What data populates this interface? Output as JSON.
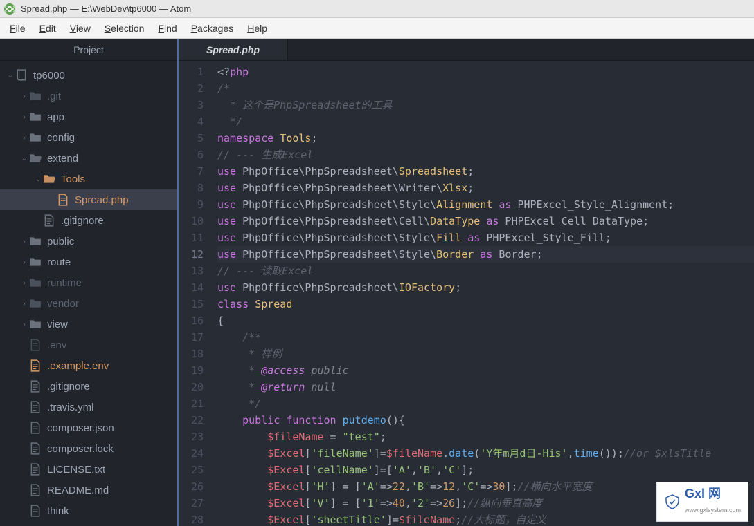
{
  "window": {
    "title": "Spread.php — E:\\WebDev\\tp6000 — Atom"
  },
  "menu": {
    "items": [
      "File",
      "Edit",
      "View",
      "Selection",
      "Find",
      "Packages",
      "Help"
    ]
  },
  "sidebar": {
    "title": "Project",
    "tree": [
      {
        "depth": 0,
        "name": "tp6000",
        "type": "repo",
        "expanded": true
      },
      {
        "depth": 1,
        "name": ".git",
        "type": "folder",
        "collapsed": true,
        "ignored": true
      },
      {
        "depth": 1,
        "name": "app",
        "type": "folder",
        "collapsed": true
      },
      {
        "depth": 1,
        "name": "config",
        "type": "folder",
        "collapsed": true
      },
      {
        "depth": 1,
        "name": "extend",
        "type": "folder",
        "expanded": true
      },
      {
        "depth": 2,
        "name": "Tools",
        "type": "folder",
        "expanded": true,
        "modified": true
      },
      {
        "depth": 3,
        "name": "Spread.php",
        "type": "file",
        "selected": true,
        "modified": true
      },
      {
        "depth": 2,
        "name": ".gitignore",
        "type": "file"
      },
      {
        "depth": 1,
        "name": "public",
        "type": "folder",
        "collapsed": true
      },
      {
        "depth": 1,
        "name": "route",
        "type": "folder",
        "collapsed": true
      },
      {
        "depth": 1,
        "name": "runtime",
        "type": "folder",
        "collapsed": true,
        "ignored": true
      },
      {
        "depth": 1,
        "name": "vendor",
        "type": "folder",
        "collapsed": true,
        "ignored": true
      },
      {
        "depth": 1,
        "name": "view",
        "type": "folder",
        "collapsed": true
      },
      {
        "depth": 1,
        "name": ".env",
        "type": "file",
        "ignored": true
      },
      {
        "depth": 1,
        "name": ".example.env",
        "type": "file",
        "modified": true
      },
      {
        "depth": 1,
        "name": ".gitignore",
        "type": "file"
      },
      {
        "depth": 1,
        "name": ".travis.yml",
        "type": "file"
      },
      {
        "depth": 1,
        "name": "composer.json",
        "type": "file"
      },
      {
        "depth": 1,
        "name": "composer.lock",
        "type": "file"
      },
      {
        "depth": 1,
        "name": "LICENSE.txt",
        "type": "file"
      },
      {
        "depth": 1,
        "name": "README.md",
        "type": "file"
      },
      {
        "depth": 1,
        "name": "think",
        "type": "file"
      }
    ]
  },
  "tabs": {
    "active": "Spread.php"
  },
  "editor": {
    "highlight_line": 12,
    "lines": [
      {
        "n": 1,
        "tokens": [
          [
            "pun",
            "<?"
          ],
          [
            "kw",
            "php"
          ]
        ]
      },
      {
        "n": 2,
        "tokens": [
          [
            "cm",
            "/*"
          ]
        ]
      },
      {
        "n": 3,
        "tokens": [
          [
            "cm",
            "  * 这个是PhpSpreadsheet的工具"
          ]
        ]
      },
      {
        "n": 4,
        "tokens": [
          [
            "cm",
            "  */"
          ]
        ]
      },
      {
        "n": 5,
        "tokens": [
          [
            "kw",
            "namespace"
          ],
          [
            "op",
            " "
          ],
          [
            "cls",
            "Tools"
          ],
          [
            "pun",
            ";"
          ]
        ]
      },
      {
        "n": 6,
        "tokens": [
          [
            "cm",
            "// --- 生成Excel"
          ]
        ]
      },
      {
        "n": 7,
        "tokens": [
          [
            "kw",
            "use"
          ],
          [
            "op",
            " PhpOffice\\PhpSpreadsheet\\"
          ],
          [
            "cls",
            "Spreadsheet"
          ],
          [
            "pun",
            ";"
          ]
        ]
      },
      {
        "n": 8,
        "tokens": [
          [
            "kw",
            "use"
          ],
          [
            "op",
            " PhpOffice\\PhpSpreadsheet\\Writer\\"
          ],
          [
            "cls",
            "Xlsx"
          ],
          [
            "pun",
            ";"
          ]
        ]
      },
      {
        "n": 9,
        "tokens": [
          [
            "kw",
            "use"
          ],
          [
            "op",
            " PhpOffice\\PhpSpreadsheet\\Style\\"
          ],
          [
            "cls",
            "Alignment"
          ],
          [
            "op",
            " "
          ],
          [
            "kw",
            "as"
          ],
          [
            "op",
            " PHPExcel_Style_Alignment"
          ],
          [
            "pun",
            ";"
          ]
        ]
      },
      {
        "n": 10,
        "tokens": [
          [
            "kw",
            "use"
          ],
          [
            "op",
            " PhpOffice\\PhpSpreadsheet\\Cell\\"
          ],
          [
            "cls",
            "DataType"
          ],
          [
            "op",
            " "
          ],
          [
            "kw",
            "as"
          ],
          [
            "op",
            " PHPExcel_Cell_DataType"
          ],
          [
            "pun",
            ";"
          ]
        ]
      },
      {
        "n": 11,
        "tokens": [
          [
            "kw",
            "use"
          ],
          [
            "op",
            " PhpOffice\\PhpSpreadsheet\\Style\\"
          ],
          [
            "cls",
            "Fill"
          ],
          [
            "op",
            " "
          ],
          [
            "kw",
            "as"
          ],
          [
            "op",
            " PHPExcel_Style_Fill"
          ],
          [
            "pun",
            ";"
          ]
        ]
      },
      {
        "n": 12,
        "tokens": [
          [
            "kw",
            "use"
          ],
          [
            "op",
            " PhpOffice\\PhpSpreadsheet\\Style\\"
          ],
          [
            "cls",
            "Border"
          ],
          [
            "op",
            " "
          ],
          [
            "kw",
            "as"
          ],
          [
            "op",
            " Border"
          ],
          [
            "pun",
            ";"
          ]
        ]
      },
      {
        "n": 13,
        "tokens": [
          [
            "cm",
            "// --- 读取Excel"
          ]
        ]
      },
      {
        "n": 14,
        "tokens": [
          [
            "kw",
            "use"
          ],
          [
            "op",
            " PhpOffice\\PhpSpreadsheet\\"
          ],
          [
            "cls",
            "IOFactory"
          ],
          [
            "pun",
            ";"
          ]
        ]
      },
      {
        "n": 15,
        "tokens": [
          [
            "kw",
            "class"
          ],
          [
            "op",
            " "
          ],
          [
            "cls",
            "Spread"
          ]
        ]
      },
      {
        "n": 16,
        "tokens": [
          [
            "pun",
            "{"
          ]
        ]
      },
      {
        "n": 17,
        "tokens": [
          [
            "cm",
            "    /**"
          ]
        ]
      },
      {
        "n": 18,
        "tokens": [
          [
            "cm",
            "     * 样例"
          ]
        ]
      },
      {
        "n": 19,
        "tokens": [
          [
            "cm",
            "     * "
          ],
          [
            "dockey",
            "@access"
          ],
          [
            "cm2",
            " public"
          ]
        ]
      },
      {
        "n": 20,
        "tokens": [
          [
            "cm",
            "     * "
          ],
          [
            "dockey",
            "@return"
          ],
          [
            "cm2",
            " null"
          ]
        ]
      },
      {
        "n": 21,
        "tokens": [
          [
            "cm",
            "     */"
          ]
        ]
      },
      {
        "n": 22,
        "tokens": [
          [
            "op",
            "    "
          ],
          [
            "kw",
            "public"
          ],
          [
            "op",
            " "
          ],
          [
            "kw",
            "function"
          ],
          [
            "op",
            " "
          ],
          [
            "fn",
            "putdemo"
          ],
          [
            "pun",
            "(){"
          ]
        ]
      },
      {
        "n": 23,
        "tokens": [
          [
            "op",
            "        "
          ],
          [
            "var",
            "$fileName"
          ],
          [
            "op",
            " = "
          ],
          [
            "str",
            "\"test\""
          ],
          [
            "pun",
            ";"
          ]
        ]
      },
      {
        "n": 24,
        "tokens": [
          [
            "op",
            "        "
          ],
          [
            "var",
            "$Excel"
          ],
          [
            "pun",
            "["
          ],
          [
            "str",
            "'fileName'"
          ],
          [
            "pun",
            "]="
          ],
          [
            "var",
            "$fileName"
          ],
          [
            "pun",
            "."
          ],
          [
            "fn",
            "date"
          ],
          [
            "pun",
            "("
          ],
          [
            "str",
            "'Y年m月d日-His'"
          ],
          [
            "pun",
            ","
          ],
          [
            "fn",
            "time"
          ],
          [
            "pun",
            "());"
          ],
          [
            "cm",
            "//or $xlsTitle"
          ]
        ]
      },
      {
        "n": 25,
        "tokens": [
          [
            "op",
            "        "
          ],
          [
            "var",
            "$Excel"
          ],
          [
            "pun",
            "["
          ],
          [
            "str",
            "'cellName'"
          ],
          [
            "pun",
            "]=["
          ],
          [
            "str",
            "'A'"
          ],
          [
            "pun",
            ","
          ],
          [
            "str",
            "'B'"
          ],
          [
            "pun",
            ","
          ],
          [
            "str",
            "'C'"
          ],
          [
            "pun",
            "];"
          ]
        ]
      },
      {
        "n": 26,
        "tokens": [
          [
            "op",
            "        "
          ],
          [
            "var",
            "$Excel"
          ],
          [
            "pun",
            "["
          ],
          [
            "str",
            "'H'"
          ],
          [
            "pun",
            "] = ["
          ],
          [
            "str",
            "'A'"
          ],
          [
            "pun",
            "=>"
          ],
          [
            "num",
            "22"
          ],
          [
            "pun",
            ","
          ],
          [
            "str",
            "'B'"
          ],
          [
            "pun",
            "=>"
          ],
          [
            "num",
            "12"
          ],
          [
            "pun",
            ","
          ],
          [
            "str",
            "'C'"
          ],
          [
            "pun",
            "=>"
          ],
          [
            "num",
            "30"
          ],
          [
            "pun",
            "];"
          ],
          [
            "cm",
            "//横向水平宽度"
          ]
        ]
      },
      {
        "n": 27,
        "tokens": [
          [
            "op",
            "        "
          ],
          [
            "var",
            "$Excel"
          ],
          [
            "pun",
            "["
          ],
          [
            "str",
            "'V'"
          ],
          [
            "pun",
            "] = ["
          ],
          [
            "str",
            "'1'"
          ],
          [
            "pun",
            "=>"
          ],
          [
            "num",
            "40"
          ],
          [
            "pun",
            ","
          ],
          [
            "str",
            "'2'"
          ],
          [
            "pun",
            "=>"
          ],
          [
            "num",
            "26"
          ],
          [
            "pun",
            "];"
          ],
          [
            "cm",
            "//纵向垂直高度"
          ]
        ]
      },
      {
        "n": 28,
        "tokens": [
          [
            "op",
            "        "
          ],
          [
            "var",
            "$Excel"
          ],
          [
            "pun",
            "["
          ],
          [
            "str",
            "'sheetTitle'"
          ],
          [
            "pun",
            "]="
          ],
          [
            "var",
            "$fileName"
          ],
          [
            "pun",
            ";"
          ],
          [
            "cm",
            "//大标题，自定义"
          ]
        ]
      }
    ]
  },
  "watermark": {
    "name": "Gxl 网",
    "url": "www.gxlsystem.com"
  }
}
